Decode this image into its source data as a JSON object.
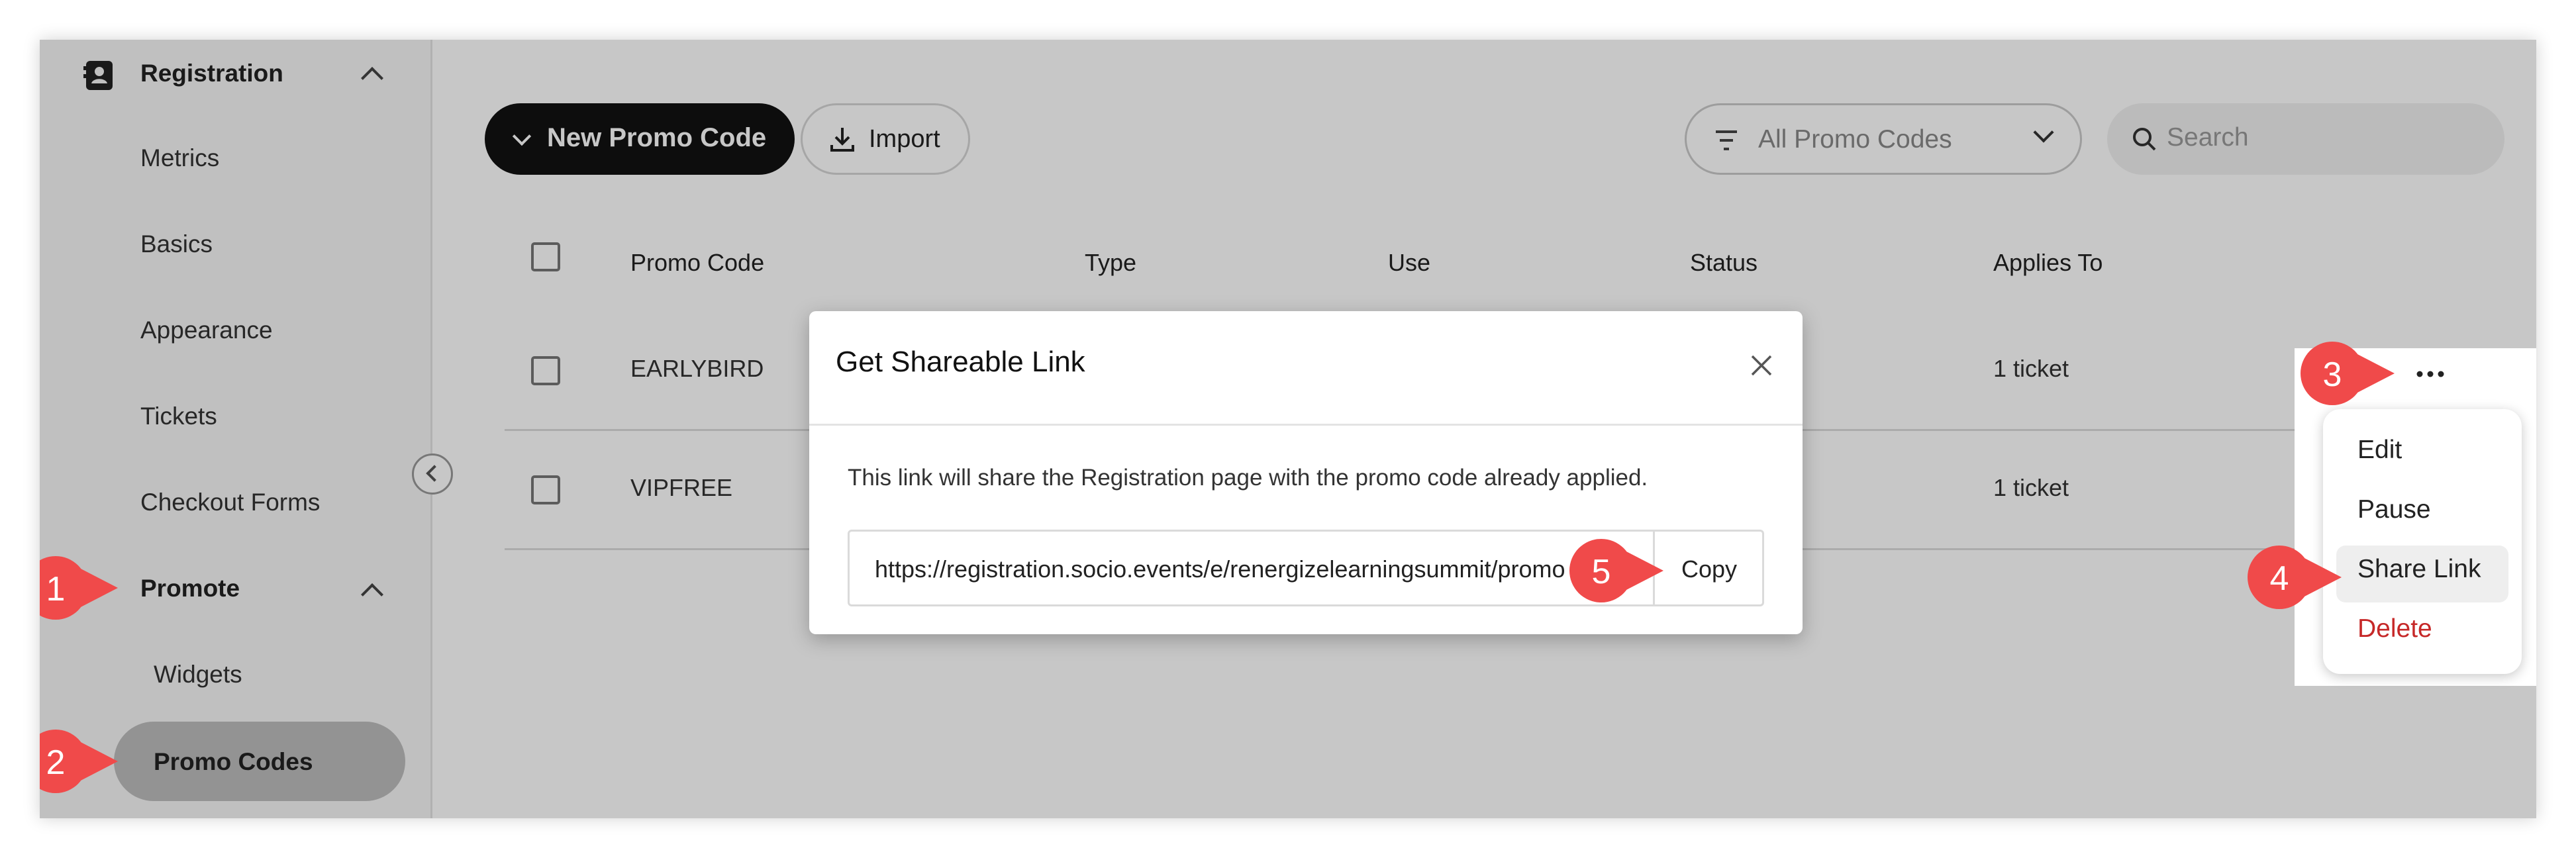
{
  "sidebar": {
    "registration_group": "Registration",
    "items_registration": [
      "Metrics",
      "Basics",
      "Appearance",
      "Tickets",
      "Checkout Forms"
    ],
    "promote_group": "Promote",
    "items_promote": [
      "Widgets",
      "Promo Codes"
    ]
  },
  "toolbar": {
    "new_promo_label": "New Promo Code",
    "import_label": "Import",
    "filter_value": "All Promo Codes",
    "search_placeholder": "Search"
  },
  "table": {
    "columns": [
      "Promo Code",
      "Type",
      "Use",
      "Status",
      "Applies To"
    ],
    "rows": [
      {
        "code": "EARLYBIRD",
        "applies_to": "1 ticket"
      },
      {
        "code": "VIPFREE",
        "applies_to": "1 ticket"
      }
    ]
  },
  "modal": {
    "title": "Get Shareable Link",
    "description": "This link will share the Registration page with the promo code already applied.",
    "link": "https://registration.socio.events/e/renergizelearningsummit/promo",
    "copy_label": "Copy"
  },
  "row_menu": {
    "more_label": "···",
    "items": [
      "Edit",
      "Pause",
      "Share Link",
      "Delete"
    ]
  },
  "markers": [
    "1",
    "2",
    "3",
    "4",
    "5"
  ],
  "colors": {
    "marker_red": "#f04a4a",
    "delete_red": "#c62828",
    "primary_button": "#111111"
  }
}
